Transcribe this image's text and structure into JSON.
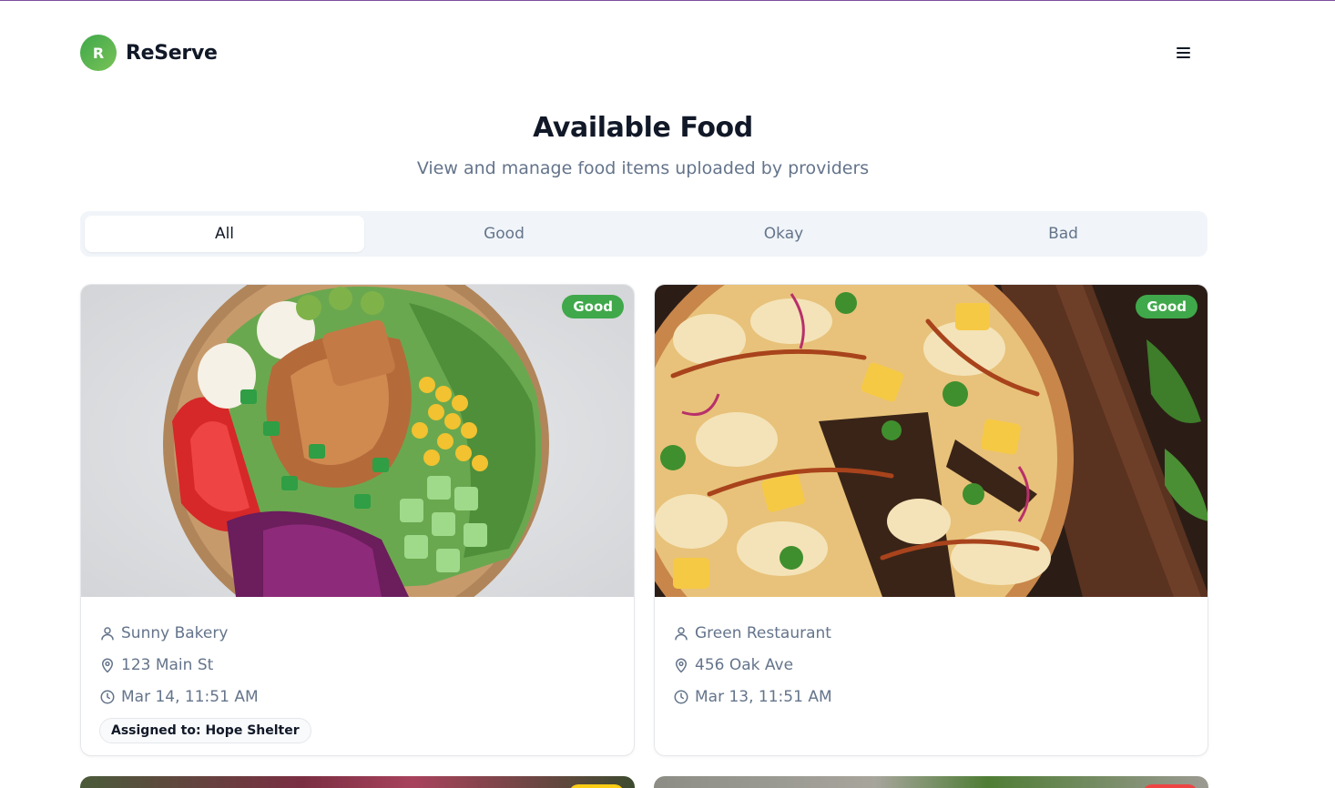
{
  "app": {
    "logo_letter": "R",
    "name": "ReServe"
  },
  "page": {
    "title": "Available Food",
    "subtitle": "View and manage food items uploaded by providers"
  },
  "tabs": [
    {
      "label": "All",
      "active": true
    },
    {
      "label": "Good",
      "active": false
    },
    {
      "label": "Okay",
      "active": false
    },
    {
      "label": "Bad",
      "active": false
    }
  ],
  "cards": [
    {
      "quality": "Good",
      "provider": "Sunny Bakery",
      "address": "123 Main St",
      "time": "Mar 14, 11:51 AM",
      "assigned": "Assigned to: Hope Shelter"
    },
    {
      "quality": "Good",
      "provider": "Green Restaurant",
      "address": "456 Oak Ave",
      "time": "Mar 13, 11:51 AM"
    }
  ],
  "colors": {
    "brand_green": "#3fa84a",
    "badge_good": "#3fa84a",
    "badge_okay": "#facc15",
    "badge_bad": "#ef4444",
    "text_muted": "#64748b",
    "tab_bg": "#f1f5f9"
  },
  "icons": [
    "menu-icon",
    "user-icon",
    "map-pin-icon",
    "clock-icon"
  ]
}
